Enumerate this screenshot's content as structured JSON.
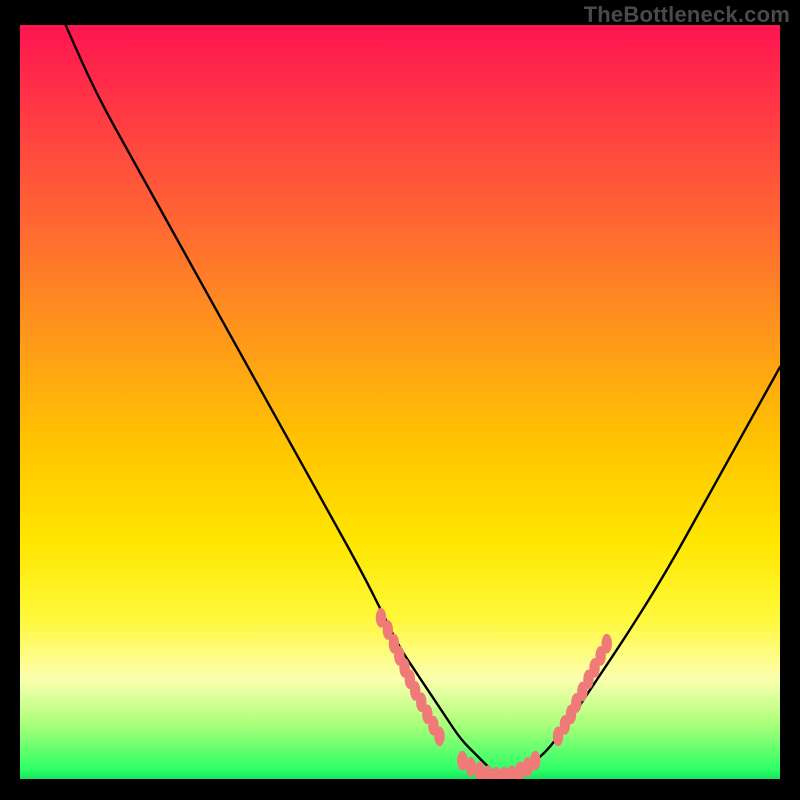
{
  "watermark": "TheBottleneck.com",
  "colors": {
    "background": "#000000",
    "curve": "#000000",
    "marker_fill": "#ef7a78",
    "marker_stroke": "#ef7a78",
    "watermark_text": "#4a4a4a"
  },
  "chart_data": {
    "type": "line",
    "title": "",
    "xlabel": "",
    "ylabel": "",
    "xlim": [
      0,
      100
    ],
    "ylim": [
      0,
      100
    ],
    "grid": false,
    "legend": false,
    "curve": {
      "description": "Single V-shaped curve. x in [0,100], y in [0,100]. y≈0 near the minimum at x≈63; y≈100 at x≈6; y≈55 at x=100.",
      "x": [
        6,
        10,
        15,
        20,
        25,
        30,
        35,
        40,
        45,
        48,
        50,
        52,
        54,
        56,
        58,
        60,
        62,
        63,
        64,
        66,
        69,
        72,
        76,
        80,
        85,
        90,
        95,
        100
      ],
      "y": [
        100,
        91,
        82,
        73,
        64,
        55,
        46,
        37,
        28,
        22,
        18,
        15,
        12,
        9,
        6,
        4,
        2,
        1,
        1,
        2,
        4,
        8,
        14,
        20,
        28,
        37,
        46,
        55
      ]
    },
    "markers_left": {
      "description": "Cluster of salmon oval markers along the left descending limb, near y≈6–22.",
      "points": [
        {
          "x": 47.5,
          "y": 22.0
        },
        {
          "x": 48.4,
          "y": 20.4
        },
        {
          "x": 49.2,
          "y": 18.6
        },
        {
          "x": 49.9,
          "y": 17.0
        },
        {
          "x": 50.6,
          "y": 15.4
        },
        {
          "x": 51.3,
          "y": 13.9
        },
        {
          "x": 52.0,
          "y": 12.4
        },
        {
          "x": 52.8,
          "y": 10.9
        },
        {
          "x": 53.6,
          "y": 9.3
        },
        {
          "x": 54.4,
          "y": 7.8
        },
        {
          "x": 55.2,
          "y": 6.4
        }
      ]
    },
    "markers_bottom": {
      "description": "Cluster of salmon oval markers along the trough, y≈1–3.",
      "points": [
        {
          "x": 58.2,
          "y": 3.2
        },
        {
          "x": 59.3,
          "y": 2.4
        },
        {
          "x": 60.5,
          "y": 1.8
        },
        {
          "x": 61.6,
          "y": 1.3
        },
        {
          "x": 62.7,
          "y": 1.1
        },
        {
          "x": 63.7,
          "y": 1.1
        },
        {
          "x": 64.7,
          "y": 1.3
        },
        {
          "x": 65.8,
          "y": 1.8
        },
        {
          "x": 66.8,
          "y": 2.4
        },
        {
          "x": 67.8,
          "y": 3.2
        }
      ]
    },
    "markers_right": {
      "description": "Cluster of salmon oval markers along the right ascending limb, y≈6–18.",
      "points": [
        {
          "x": 70.8,
          "y": 6.4
        },
        {
          "x": 71.7,
          "y": 7.9
        },
        {
          "x": 72.5,
          "y": 9.3
        },
        {
          "x": 73.2,
          "y": 10.8
        },
        {
          "x": 74.0,
          "y": 12.3
        },
        {
          "x": 74.8,
          "y": 13.9
        },
        {
          "x": 75.6,
          "y": 15.4
        },
        {
          "x": 76.4,
          "y": 17.0
        },
        {
          "x": 77.2,
          "y": 18.6
        }
      ]
    }
  }
}
